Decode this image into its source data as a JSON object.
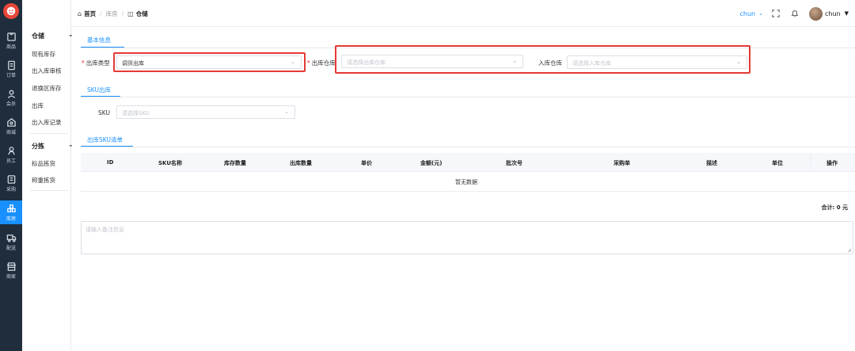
{
  "rail": {
    "items": [
      {
        "label": "商品",
        "icon": "goods-icon"
      },
      {
        "label": "订单",
        "icon": "order-icon"
      },
      {
        "label": "会员",
        "icon": "member-icon"
      },
      {
        "label": "商城",
        "icon": "mall-icon"
      },
      {
        "label": "员工",
        "icon": "staff-icon"
      },
      {
        "label": "采购",
        "icon": "purchase-icon"
      },
      {
        "label": "库房",
        "icon": "warehouse-icon",
        "active": true
      },
      {
        "label": "配送",
        "icon": "delivery-icon"
      },
      {
        "label": "商家",
        "icon": "merchant-icon"
      }
    ],
    "active_color": "#1890ff",
    "bg_color": "#1f2d3d"
  },
  "submenu": {
    "group1": {
      "label": "仓储",
      "items": [
        "现有库存",
        "出入库审核",
        "退换区库存",
        "出库",
        "出入库记录"
      ]
    },
    "group2": {
      "label": "分拣",
      "items": [
        "标品拣货",
        "称重拣货"
      ]
    }
  },
  "header": {
    "breadcrumb": {
      "home": "首页",
      "mid": "库房",
      "current": "仓储"
    },
    "user_link": "chun",
    "user_name": "chun"
  },
  "tabs": {
    "basic": "基本信息",
    "sku_out": "SKU出库",
    "sku_list": "出库SKU清单"
  },
  "form": {
    "out_type_label": "出库类型",
    "out_type_value": "调货出库",
    "out_warehouse_label": "出库仓库",
    "out_warehouse_placeholder": "请选择出库仓库",
    "in_warehouse_label": "入库仓库",
    "in_warehouse_placeholder": "请选择入库仓库",
    "sku_label": "SKU",
    "sku_placeholder": "请选择SKU"
  },
  "table": {
    "columns": [
      "ID",
      "SKU名称",
      "库存数量",
      "出库数量",
      "单价",
      "金额(元)",
      "批次号",
      "采购单",
      "描述",
      "单位",
      "操作"
    ],
    "empty_text": "暂无数据",
    "total": "合计: 0 元"
  },
  "remark": {
    "placeholder": "请输入备注信息"
  },
  "colors": {
    "accent": "#1890ff",
    "required": "#f5222d",
    "highlight_box": "#e53935"
  }
}
